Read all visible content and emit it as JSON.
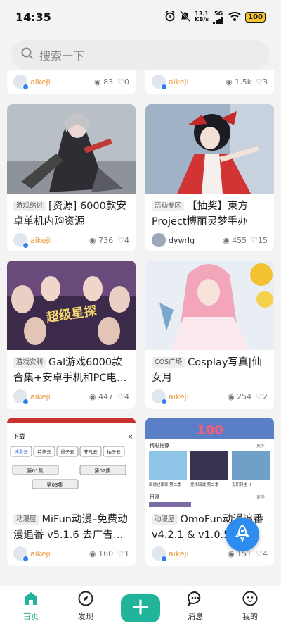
{
  "status_bar": {
    "time": "14:35",
    "net_speed_value": "13.1",
    "net_speed_unit": "KB/s",
    "signal": "5G",
    "battery": "100"
  },
  "search": {
    "placeholder": "搜索一下"
  },
  "partial_cards": [
    {
      "author": "aikeji",
      "views": "83",
      "likes": "0"
    },
    {
      "author": "aikeji",
      "views": "1.5k",
      "likes": "3"
    }
  ],
  "cards": [
    {
      "tag": "游戏综讨",
      "title": "[资源] 6000款安卓单机内购资源",
      "author": "aikeji",
      "views": "736",
      "likes": "4"
    },
    {
      "tag": "活动专区",
      "title": "【抽奖】東方Project博丽灵梦手办",
      "author": "dywrlg",
      "views": "455",
      "likes": "15"
    },
    {
      "tag": "游戏安利",
      "title": "Gal游戏6000款合集+安卓手机和PC电…",
      "author": "aikeji",
      "views": "447",
      "likes": "4"
    },
    {
      "tag": "COS广场",
      "title": "Cosplay写真|仙女月",
      "author": "aikeji",
      "views": "254",
      "likes": "2"
    },
    {
      "tag": "动漫屋",
      "title": "MiFun动漫–免费动漫追番 v5.1.6 去广告…",
      "author": "aikeji",
      "views": "160",
      "likes": "1"
    },
    {
      "tag": "动漫屋",
      "title": "OmoFun动漫追番v4.2.1 & v1.0.5…",
      "author": "aikeji",
      "views": "151",
      "likes": "4"
    }
  ],
  "image_texts": {
    "stars": "超级星探",
    "download_title": "下载",
    "download_sources": [
      "快看云",
      "特快云",
      "量子云",
      "非凡云",
      "柚子云"
    ],
    "episodes": [
      "第01集",
      "第02集",
      "第03集"
    ],
    "omo_section": "精彩推荐",
    "omo_more": "更多",
    "omo_captions": [
      "间谍过家家 第二季",
      "咒术回战 第二季",
      "无职转生 II"
    ],
    "omo_daily": "日漫",
    "omo_banner": "100"
  },
  "tabs": [
    {
      "label": "首页"
    },
    {
      "label": "发现"
    },
    {
      "label": ""
    },
    {
      "label": "消息"
    },
    {
      "label": "我的"
    }
  ],
  "colors": {
    "accent": "#22b49a",
    "author": "#e8993e",
    "fab": "#2d8cf0"
  }
}
